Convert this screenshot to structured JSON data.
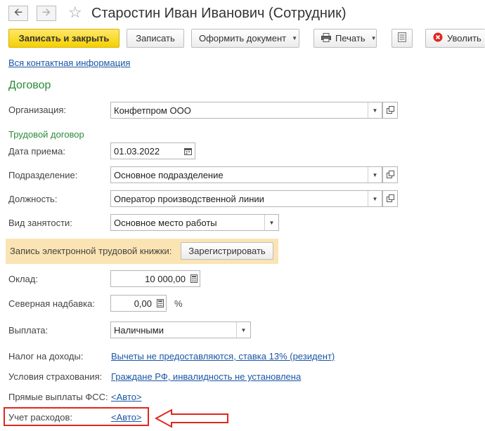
{
  "window": {
    "title": "Старостин Иван Иванович (Сотрудник)"
  },
  "toolbar": {
    "save_close": "Записать и закрыть",
    "save": "Записать",
    "create_doc": "Оформить документ",
    "print": "Печать",
    "delete": "Уволить"
  },
  "contact_link": "Вся контактная информация",
  "section_title": "Договор",
  "fields": {
    "organization": {
      "label": "Организация:",
      "value": "Конфетпром ООО"
    },
    "subsection": "Трудовой договор",
    "hire_date": {
      "label": "Дата приема:",
      "value": "01.03.2022"
    },
    "department": {
      "label": "Подразделение:",
      "value": "Основное подразделение"
    },
    "position": {
      "label": "Должность:",
      "value": "Оператор производственной линии"
    },
    "employment_type": {
      "label": "Вид занятости:",
      "value": "Основное место работы"
    },
    "etk": {
      "label": "Запись электронной трудовой книжки:",
      "button": "Зарегистрировать"
    },
    "salary": {
      "label": "Оклад:",
      "value": "10 000,00"
    },
    "north_bonus": {
      "label": "Северная надбавка:",
      "value": "0,00",
      "unit": "%"
    },
    "payment": {
      "label": "Выплата:",
      "value": "Наличными"
    },
    "income_tax": {
      "label": "Налог на доходы:",
      "value": "Вычеты не предоставляются, ставка 13% (резидент)"
    },
    "insurance": {
      "label": "Условия страхования:",
      "value": "Граждане РФ, инвалидность не установлена"
    },
    "fss_direct": {
      "label": "Прямые выплаты ФСС:",
      "value": "<Авто>"
    },
    "expenses": {
      "label": "Учет расходов:",
      "value": "<Авто>"
    }
  },
  "colors": {
    "primary_button": "#f5d000",
    "link": "#1a56a6",
    "section_green": "#2a8a3a",
    "banner": "#fbe4b3",
    "highlight_red": "#e0261e"
  }
}
